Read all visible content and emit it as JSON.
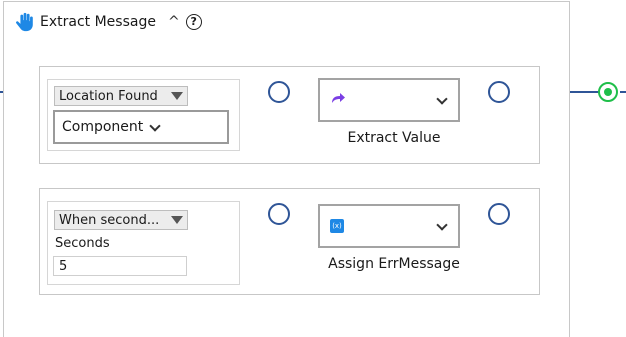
{
  "header": {
    "title": "Extract Message",
    "collapse_glyph": "^",
    "help_glyph": "?",
    "icon": "hand-icon"
  },
  "branches": [
    {
      "condition_dropdown": "Location Found",
      "component_select": "Component",
      "action_icon": "redirect-arrow-icon",
      "action_label": "Extract Value"
    },
    {
      "condition_dropdown": "When second...",
      "seconds_label": "Seconds",
      "seconds_value": "5",
      "action_icon": "variable-icon",
      "action_icon_text": "(x)",
      "action_label": "Assign ErrMessage"
    }
  ],
  "colors": {
    "wire": "#2f5597",
    "end_node": "#1fbf4a",
    "hand_icon": "#1e88e5",
    "redirect_icon": "#7b3fe4",
    "variable_icon": "#1e88e5"
  }
}
